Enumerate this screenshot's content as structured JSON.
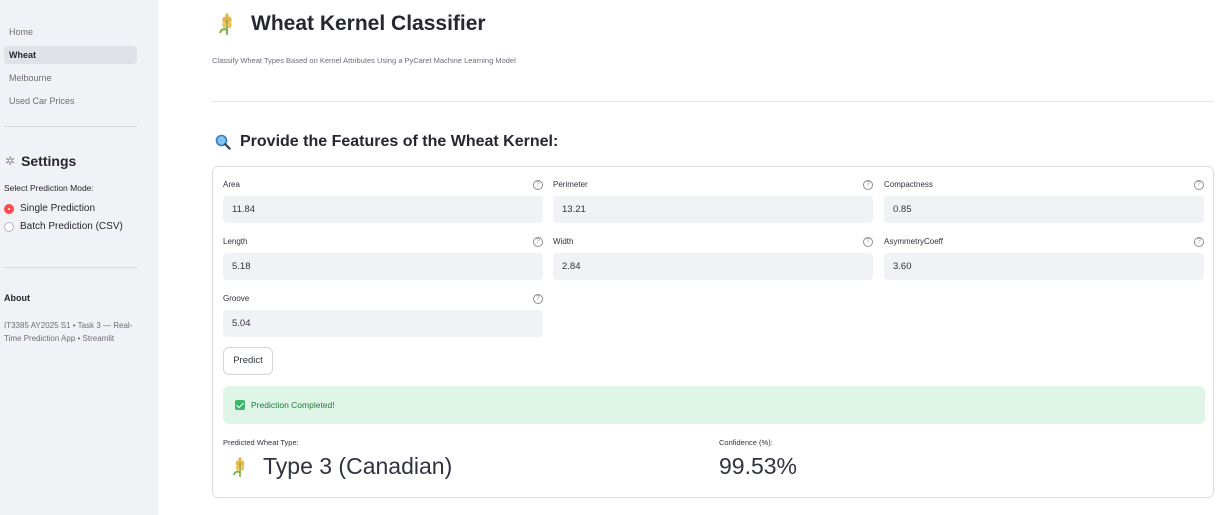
{
  "sidebar": {
    "nav": [
      {
        "label": "Home",
        "active": false
      },
      {
        "label": "Wheat",
        "active": true
      },
      {
        "label": "Melbourne",
        "active": false
      },
      {
        "label": "Used Car Prices",
        "active": false
      }
    ],
    "settings_title": "Settings",
    "mode_label": "Select Prediction Mode:",
    "modes": [
      {
        "label": "Single Prediction",
        "selected": true
      },
      {
        "label": "Batch Prediction (CSV)",
        "selected": false
      }
    ],
    "about_title": "About",
    "about_text": "IT3385 AY2025 S1 • Task 3 — Real-Time Prediction App • Streamlit"
  },
  "main": {
    "title": "Wheat Kernel Classifier",
    "subtitle": "Classify Wheat Types Based on Kernel Attributes Using a PyCaret Machine Learning Model",
    "section_title": "Provide the Features of the Wheat Kernel:",
    "fields": {
      "area": {
        "label": "Area",
        "value": "11.84"
      },
      "perimeter": {
        "label": "Perimeter",
        "value": "13.21"
      },
      "compactness": {
        "label": "Compactness",
        "value": "0.85"
      },
      "length": {
        "label": "Length",
        "value": "5.18"
      },
      "width": {
        "label": "Width",
        "value": "2.84"
      },
      "asymmetry": {
        "label": "AsymmetryCoeff",
        "value": "3.60"
      },
      "groove": {
        "label": "Groove",
        "value": "5.04"
      }
    },
    "predict_label": "Predict",
    "success_text": "Prediction Completed!",
    "result": {
      "type_label": "Predicted Wheat Type:",
      "type_value": "Type 3 (Canadian)",
      "confidence_label": "Confidence (%):",
      "confidence_value": "99.53%"
    },
    "help_glyph": "?"
  },
  "colors": {
    "accent": "#ff4b4b",
    "sidebar_bg": "#f0f2f6",
    "success_bg": "#dff5e8",
    "success_text": "#1f7a3f"
  }
}
